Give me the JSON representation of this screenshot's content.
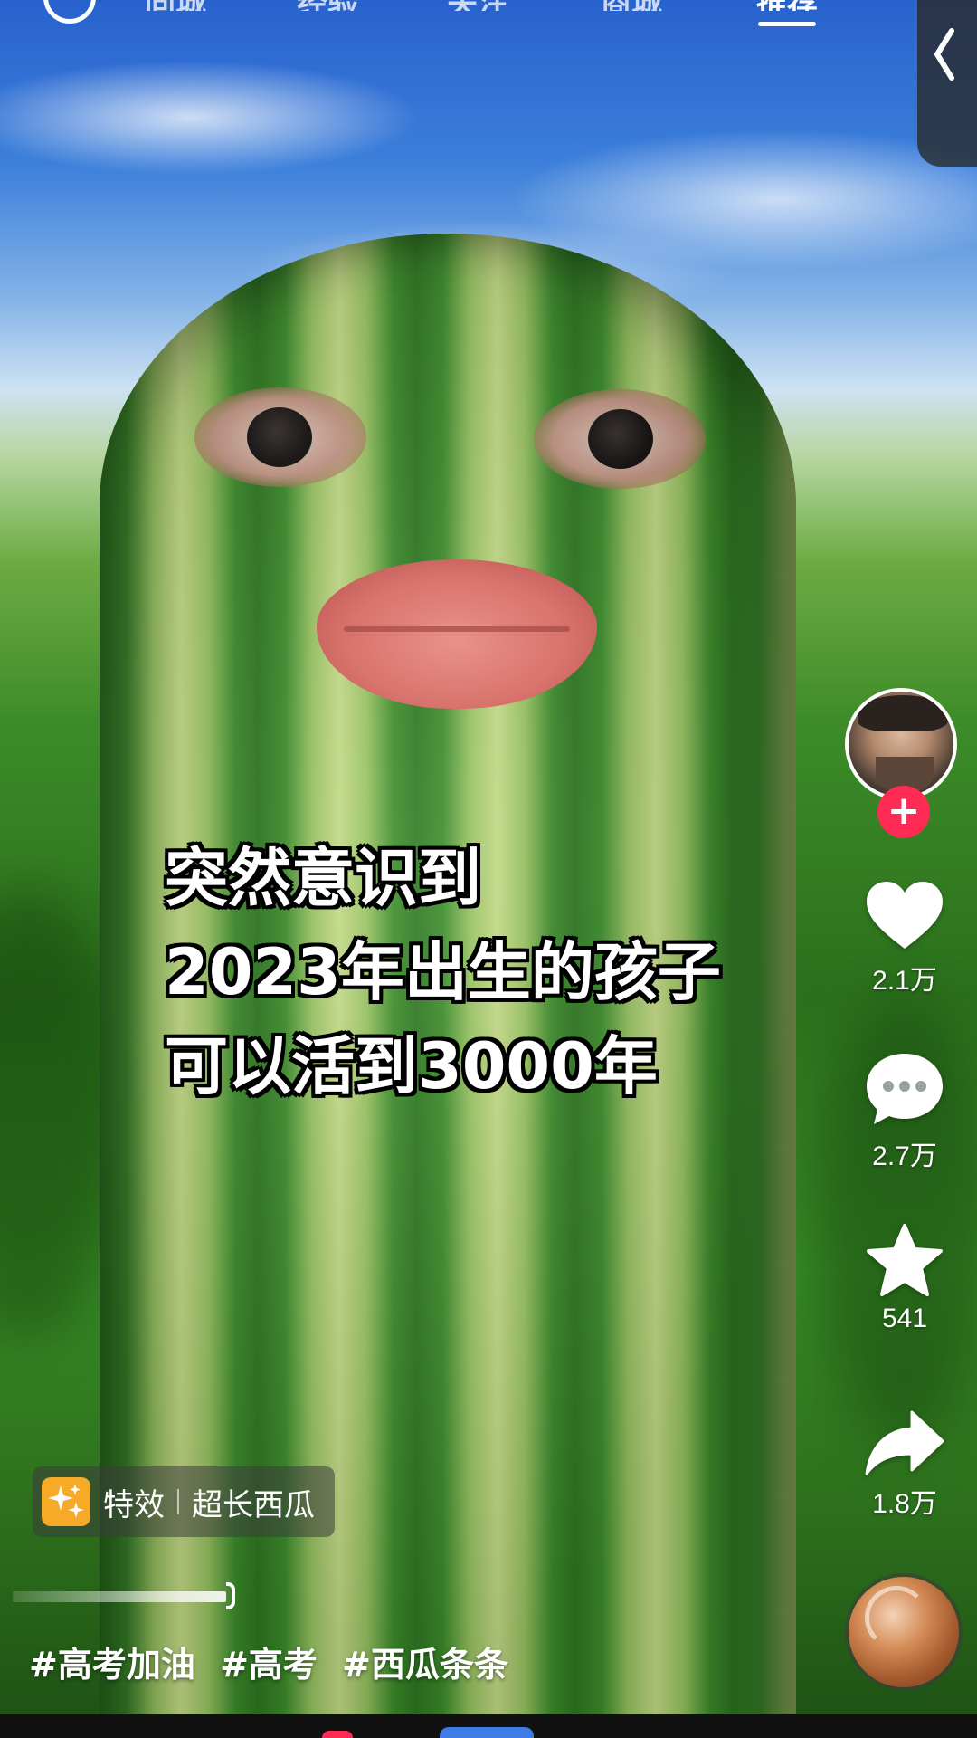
{
  "top_nav": {
    "tabs": [
      {
        "label": "同城"
      },
      {
        "label": "经验"
      },
      {
        "label": "关注"
      },
      {
        "label": "商城"
      },
      {
        "label": "推荐"
      }
    ]
  },
  "video": {
    "caption_lines": [
      "突然意识到",
      "2023年出生的孩子",
      "可以活到3000年"
    ]
  },
  "actions": {
    "like_count": "2.1万",
    "comment_count": "2.7万",
    "favorite_count": "541",
    "share_count": "1.8万",
    "follow_symbol": "+"
  },
  "effect": {
    "tag": "特效",
    "name": "超长西瓜"
  },
  "hashtags": [
    "#高考加油",
    "#高考",
    "#西瓜条条"
  ],
  "colors": {
    "follow": "#fe2c55",
    "effect_icon": "#f7a928"
  }
}
